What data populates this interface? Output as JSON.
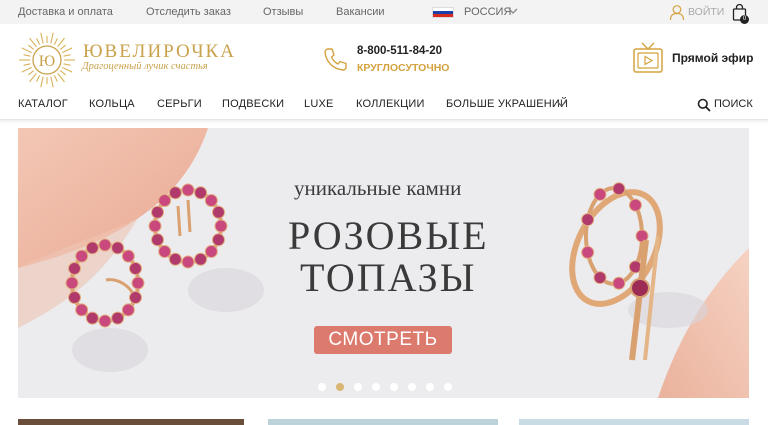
{
  "topbar": {
    "links": [
      "Доставка и оплата",
      "Отследить заказ",
      "Отзывы",
      "Вакансии"
    ],
    "country": "РОССИЯ",
    "login_label": "ВОЙТИ",
    "cart_count": "0"
  },
  "header": {
    "brand_name": "ЮВЕЛИРОЧКА",
    "logo_letters": "Ю",
    "tagline": "Драгоценный лучик счастья",
    "phone": "8-800-511-84-20",
    "phone_hours": "КРУГЛОСУТОЧНО",
    "live_label": "Прямой эфир"
  },
  "nav": {
    "items": [
      "КАТАЛОГ",
      "КОЛЬЦА",
      "СЕРЬГИ",
      "ПОДВЕСКИ",
      "LUXE",
      "КОЛЛЕКЦИИ",
      "БОЛЬШЕ УКРАШЕНИЙ"
    ],
    "search_label": "ПОИСК"
  },
  "banner": {
    "kicker": "уникальные камни",
    "title_line1": "РОЗОВЫЕ",
    "title_line2": "ТОПАЗЫ",
    "cta_label": "СМОТРЕТЬ",
    "slide_count": 8,
    "active_slide": 2
  },
  "colors": {
    "gold": "#c9a24c",
    "accent_orange": "#d4a23f",
    "cta": "#dd7a6e",
    "gem_pink": "#b03a6c",
    "peach": "#f2c1ad"
  }
}
